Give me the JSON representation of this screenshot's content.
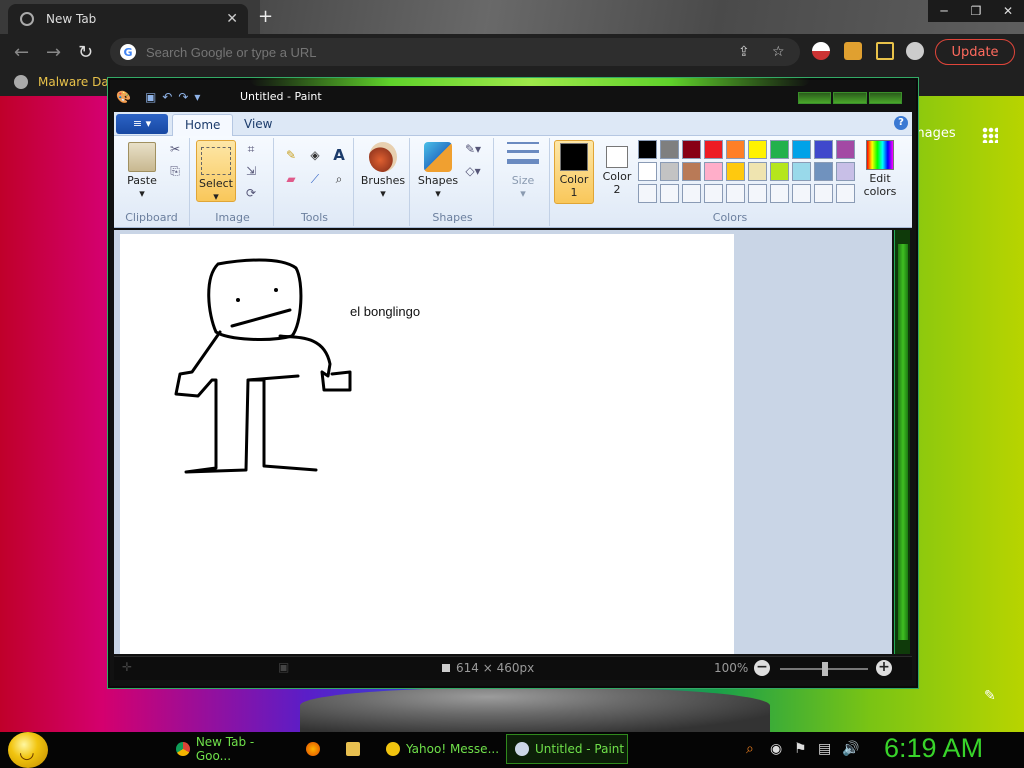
{
  "browser": {
    "tab_title": "New Tab",
    "new_tab_symbol": "+",
    "omnibox_placeholder": "Search Google or type a URL",
    "update_label": "Update",
    "bookmark_label": "Malware Dat",
    "images_link": "mages"
  },
  "paint": {
    "title": "Untitled - Paint",
    "file_menu_label": "≡ ▾",
    "tabs": [
      "Home",
      "View"
    ],
    "groups": {
      "clipboard": "Clipboard",
      "image": "Image",
      "tools": "Tools",
      "shapes": "Shapes",
      "colors": "Colors"
    },
    "buttons": {
      "paste": "Paste",
      "select": "Select",
      "brushes": "Brushes",
      "shapes": "Shapes",
      "size": "Size",
      "color1_line1": "Color",
      "color1_line2": "1",
      "color2_line1": "Color",
      "color2_line2": "2",
      "edit_colors_line1": "Edit",
      "edit_colors_line2": "colors"
    },
    "palette_row1": [
      "#000000",
      "#7f7f7f",
      "#880015",
      "#ed1c24",
      "#ff7f27",
      "#fff200",
      "#22b14c",
      "#00a2e8",
      "#3f48cc",
      "#a349a4"
    ],
    "palette_row2": [
      "#ffffff",
      "#c3c3c3",
      "#b97a57",
      "#ffaec9",
      "#ffc90e",
      "#efe4b0",
      "#b5e61d",
      "#99d9ea",
      "#7092be",
      "#c8bfe7"
    ],
    "color1": "#000000",
    "color2": "#ffffff",
    "canvas_text": "el bonglingo",
    "status_dimensions": "614 × 460px",
    "zoom": "100%"
  },
  "taskbar": {
    "tasks": [
      {
        "label": "New Tab - Goo..."
      },
      {
        "label": "Yahoo! Messe..."
      },
      {
        "label": "Untitled - Paint"
      }
    ],
    "clock": "6:19 AM"
  }
}
